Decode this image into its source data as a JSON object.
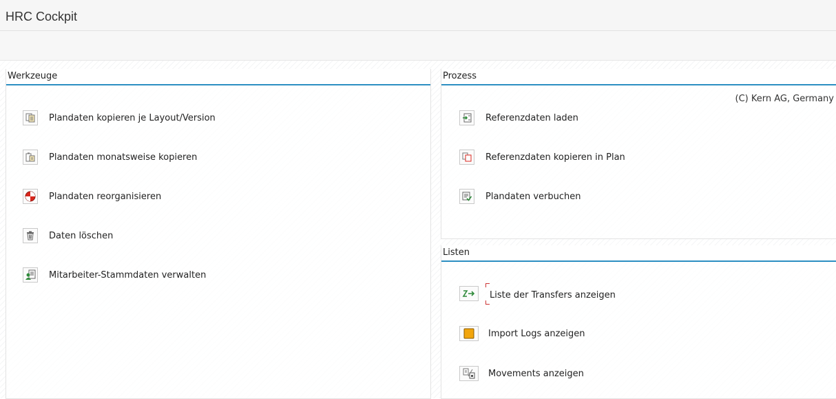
{
  "window": {
    "title": "HRC Cockpit"
  },
  "werkzeuge": {
    "header": "Werkzeuge",
    "items": [
      {
        "label": "Plandaten kopieren je Layout/Version",
        "icon": "copy-layout-icon"
      },
      {
        "label": "Plandaten monatsweise kopieren",
        "icon": "copy-monthly-icon"
      },
      {
        "label": "Plandaten reorganisieren",
        "icon": "reorganize-icon"
      },
      {
        "label": "Daten löschen",
        "icon": "trash-icon"
      },
      {
        "label": "Mitarbeiter-Stammdaten verwalten",
        "icon": "employee-data-icon"
      }
    ]
  },
  "prozess": {
    "header": "Prozess",
    "copyright": "(C) Kern AG, Germany",
    "items": [
      {
        "label": "Referenzdaten laden",
        "icon": "load-data-icon"
      },
      {
        "label": "Referenzdaten kopieren in Plan",
        "icon": "copy-icon"
      },
      {
        "label": "Plandaten verbuchen",
        "icon": "post-document-icon"
      }
    ]
  },
  "listen": {
    "header": "Listen",
    "items": [
      {
        "label": "Liste der Transfers anzeigen",
        "icon": "transfer-icon"
      },
      {
        "label": "Import Logs anzeigen",
        "icon": "log-icon"
      },
      {
        "label": "Movements anzeigen",
        "icon": "movements-icon"
      }
    ]
  }
}
